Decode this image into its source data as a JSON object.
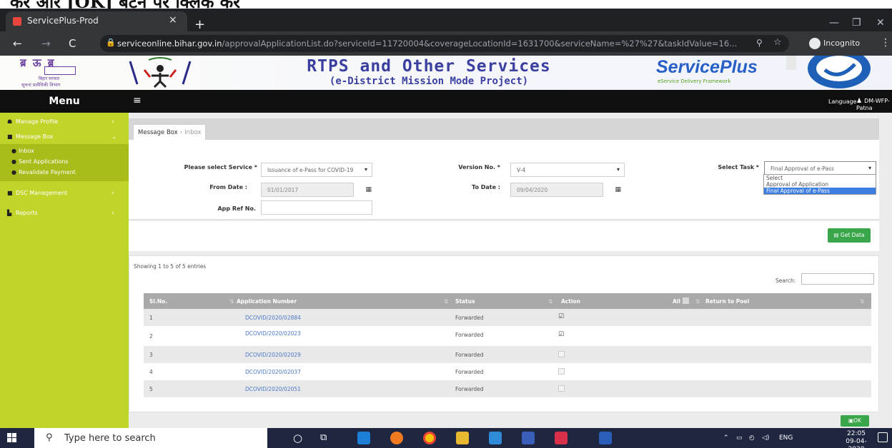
{
  "browser": {
    "tab_title": "ServicePlus-Prod",
    "tab_close": "×",
    "new_tab": "+",
    "url_domain": "serviceonline.bihar.gov.in",
    "url_path": "/approvalApplicationList.do?serviceId=11720004&coverageLocationId=1631700&serviceName=%27%27&taskIdValue=16...",
    "mode": "Incognito"
  },
  "banner": {
    "title": "RTPS and Other Services",
    "subtitle": "(e-District Mission Mode Project)",
    "brand": "ServicePlus",
    "brand_tagline": "eService Delivery Framework",
    "left_logo_small": "बिहार सरकार",
    "left_logo_dept": "सूचना प्रावैधिकी विभाग"
  },
  "topnav": {
    "menu_label": "Menu",
    "language_label": "Language",
    "user_name": "DM-WFP-Patna"
  },
  "sidebar": {
    "items": [
      {
        "label": "Manage Profile"
      },
      {
        "label": "Message Box"
      },
      {
        "label": "DSC Management"
      },
      {
        "label": "Reports"
      }
    ],
    "message_box_children": [
      {
        "label": "Inbox"
      },
      {
        "label": "Sent Applications"
      },
      {
        "label": "Revalidate Payment"
      }
    ]
  },
  "breadcrumb": {
    "root": "Message Box",
    "current": "Inbox"
  },
  "filters": {
    "service_label": "Please select Service *",
    "service_value": "Issuance of e-Pass for COVID-19",
    "version_label": "Version No. *",
    "version_value": "V-4",
    "task_label": "Select Task *",
    "task_value": "Final Approval of e-Pass",
    "task_options": [
      "Select",
      "Approval of Application",
      "Final Approval of e-Pass"
    ],
    "from_label": "From Date :",
    "from_value": "01/01/2017",
    "to_label": "To Date :",
    "to_value": "09/04/2020",
    "appref_label": "App Ref No."
  },
  "get_data_button": "Get Data",
  "table": {
    "showing": "Showing 1 to 5 of 5 entries",
    "search_label": "Search:",
    "headers": {
      "slno": "Sl.No.",
      "appno": "Application Number",
      "status": "Status",
      "action": "Action",
      "all": "All",
      "return_pool": "Return to Pool"
    },
    "rows": [
      {
        "slno": "1",
        "appno": "DCOVID/2020/02884",
        "status": "Forwarded",
        "checked": true
      },
      {
        "slno": "2",
        "appno": "DCOVID/2020/02023",
        "status": "Forwarded",
        "checked": true
      },
      {
        "slno": "3",
        "appno": "DCOVID/2020/02029",
        "status": "Forwarded",
        "checked": false
      },
      {
        "slno": "4",
        "appno": "DCOVID/2020/02037",
        "status": "Forwarded",
        "checked": false
      },
      {
        "slno": "5",
        "appno": "DCOVID/2020/02051",
        "status": "Forwarded",
        "checked": false
      }
    ]
  },
  "ok_button": "OK",
  "taskbar": {
    "search_placeholder": "Type here to search",
    "lang": "ENG",
    "time": "22:05",
    "date": "09-04-2020"
  }
}
